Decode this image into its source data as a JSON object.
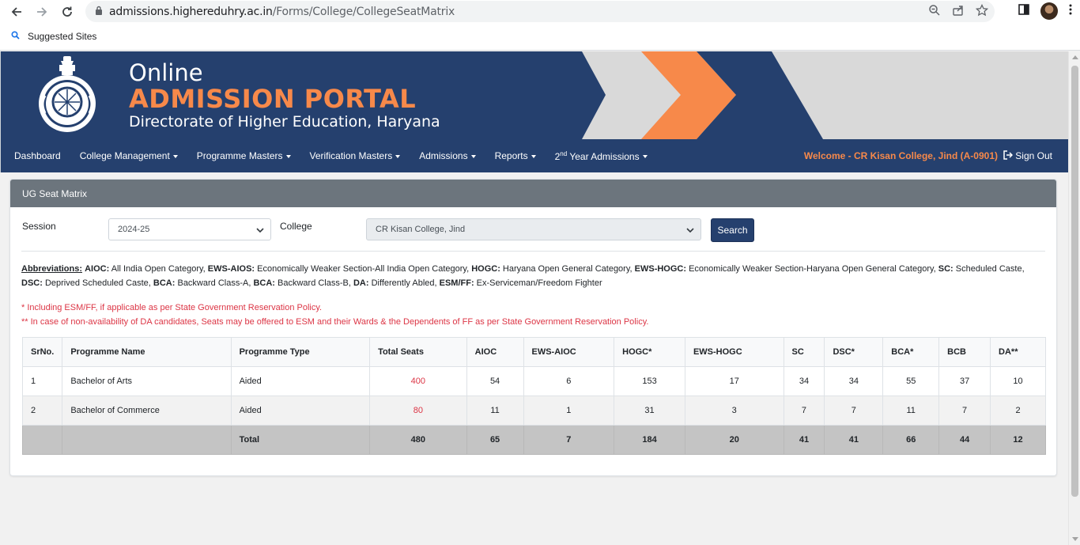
{
  "browser": {
    "url_host": "admissions.higheredu hry.ac.in",
    "url_host_exact": "admissions.higheredu",
    "url_host_rest": "hry.ac.in",
    "url_path": "/Forms/College/CollegeSeatMatrix",
    "bookmark": "Suggested Sites"
  },
  "banner": {
    "line1": "Online",
    "line2": "ADMISSION PORTAL",
    "line3": "Directorate of Higher Education, Haryana"
  },
  "nav": {
    "items": [
      {
        "label": "Dashboard"
      },
      {
        "label": "College Management"
      },
      {
        "label": "Programme Masters"
      },
      {
        "label": "Verification Masters"
      },
      {
        "label": "Admissions"
      },
      {
        "label": "Reports"
      },
      {
        "label_pre": "2",
        "label_sup": "nd",
        "label_post": " Year Admissions"
      }
    ],
    "welcome": "Welcome - CR Kisan College, Jind (A-0901)",
    "signout": "Sign Out"
  },
  "card": {
    "title": "UG Seat Matrix",
    "session_label": "Session",
    "session_value": "2024-25",
    "college_label": "College",
    "college_value": "CR Kisan College, Jind",
    "search_label": "Search"
  },
  "abbreviations": {
    "heading": "Abbreviations:",
    "entries": [
      {
        "k": "AIOC:",
        "v": " All India Open Category, "
      },
      {
        "k": "EWS-AIOS:",
        "v": " Economically Weaker Section-All India Open Category, "
      },
      {
        "k": "HOGC:",
        "v": " Haryana Open General Category, "
      },
      {
        "k": "EWS-HOGC:",
        "v": " Economically Weaker Section-Haryana Open General Category, "
      },
      {
        "k": "SC:",
        "v": " Scheduled Caste, "
      },
      {
        "k": "DSC:",
        "v": " Deprived Scheduled Caste, "
      },
      {
        "k": "BCA:",
        "v": " Backward Class-A, "
      },
      {
        "k": "BCA:",
        "v": " Backward Class-B, "
      },
      {
        "k": "DA:",
        "v": " Differently Abled, "
      },
      {
        "k": "ESM/FF:",
        "v": " Ex-Serviceman/Freedom Fighter"
      }
    ],
    "note1": "* Including ESM/FF, if applicable as per State Government Reservation Policy.",
    "note2": "** In case of non-availability of DA candidates, Seats may be offered to ESM and their Wards & the Dependents of FF as per State Government Reservation Policy."
  },
  "table": {
    "headers": [
      "SrNo.",
      "Programme Name",
      "Programme Type",
      "Total Seats",
      "AIOC",
      "EWS-AIOC",
      "HOGC*",
      "EWS-HOGC",
      "SC",
      "DSC*",
      "BCA*",
      "BCB",
      "DA**"
    ],
    "rows": [
      [
        "1",
        "Bachelor of Arts",
        "Aided",
        "400",
        "54",
        "6",
        "153",
        "17",
        "34",
        "34",
        "55",
        "37",
        "10"
      ],
      [
        "2",
        "Bachelor of Commerce",
        "Aided",
        "80",
        "11",
        "1",
        "31",
        "3",
        "7",
        "7",
        "11",
        "7",
        "2"
      ]
    ],
    "total": [
      "",
      "",
      "Total",
      "480",
      "65",
      "7",
      "184",
      "20",
      "41",
      "41",
      "66",
      "44",
      "12"
    ]
  },
  "colors": {
    "navy": "#25406e",
    "orange": "#f7894a",
    "card_header": "#6c757d",
    "red_text": "#dc3545"
  }
}
